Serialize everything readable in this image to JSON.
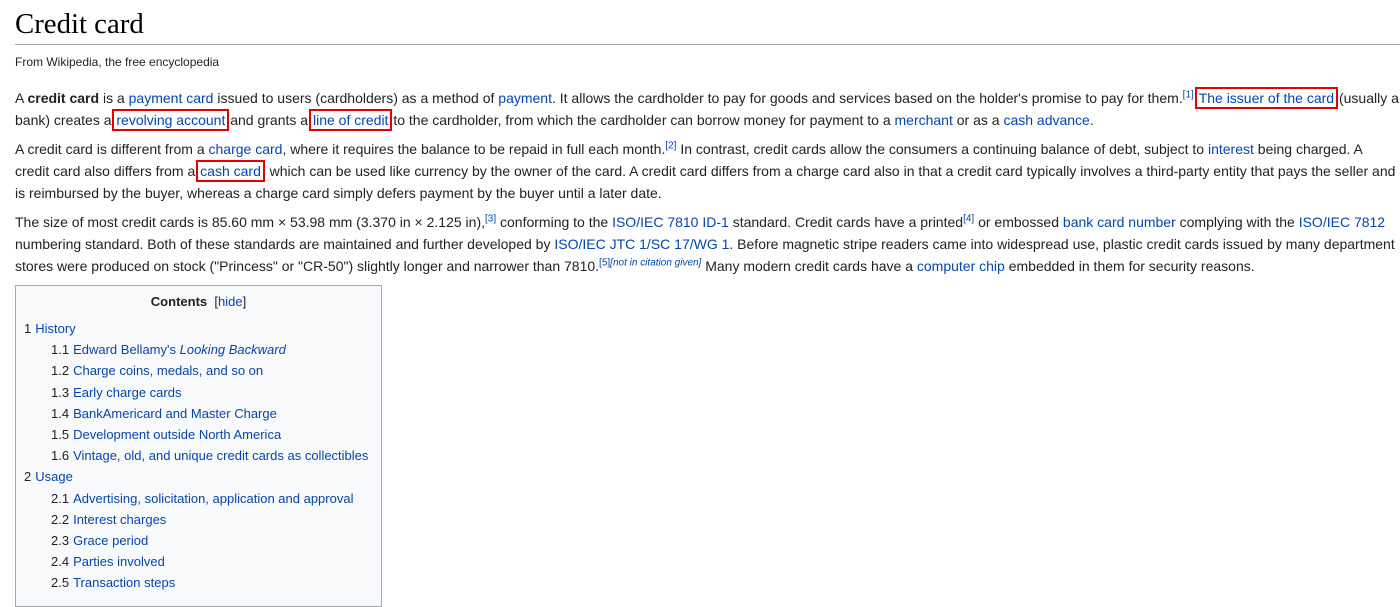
{
  "title": "Credit card",
  "subtitle": "From Wikipedia, the free encyclopedia",
  "para1": {
    "t1": "A ",
    "b1": "credit card",
    "t2": " is a ",
    "l1": "payment card",
    "t3": " issued to users (cardholders) as a method of ",
    "l2": "payment",
    "t4": ". It allows the cardholder to pay for goods and services based on the holder's promise to pay for them.",
    "s1": "[1]",
    "t5": " ",
    "h1": "The issuer of the card",
    "t6": " (usually a bank) creates a ",
    "h2": "revolving account",
    "t7": " and grants a ",
    "h3": "line of credit",
    "t8": " to the cardholder, from which the cardholder can borrow money for payment to a ",
    "l3": "merchant",
    "t9": " or as a ",
    "l4": "cash advance",
    "t10": "."
  },
  "para2": {
    "t1": "A credit card is different from a ",
    "l1": "charge card",
    "t2": ", where it requires the balance to be repaid in full each month.",
    "s1": "[2]",
    "t3": " In contrast, credit cards allow the consumers a continuing balance of debt, subject to ",
    "l2": "interest",
    "t4": " being charged. A credit card also differs from a ",
    "h1": "cash card",
    "t5": ", which can be used like currency by the owner of the card. A credit card differs from a charge card also in that a credit card typically involves a third-party entity that pays the seller and is reimbursed by the buyer, whereas a charge card simply defers payment by the buyer until a later date."
  },
  "para3": {
    "t1": "The size of most credit cards is 85.60 mm × 53.98 mm (3.370 in × 2.125 in),",
    "s1": "[3]",
    "t2": " conforming to the ",
    "l1": "ISO/IEC 7810",
    "t3": " ",
    "l2": "ID-1",
    "t4": " standard. Credit cards have a printed",
    "s2": "[4]",
    "t5": " or embossed ",
    "l3": "bank card number",
    "t6": " complying with the ",
    "l4": "ISO/IEC 7812",
    "t7": " numbering standard. Both of these standards are maintained and further developed by ",
    "l5": "ISO/IEC JTC 1/SC 17/WG 1",
    "t8": ". Before magnetic stripe readers came into widespread use, plastic credit cards issued by many department stores were produced on stock (\"Princess\" or \"CR-50\") slightly longer and narrower than 7810.",
    "s3": "[5]",
    "s4": "[not in citation given]",
    "t9": " Many modern credit cards have a ",
    "l6": "computer chip",
    "t10": " embedded in them for security reasons."
  },
  "toc": {
    "title": "Contents",
    "hide_open": "[",
    "hide": "hide",
    "hide_close": "]",
    "items": [
      {
        "num": "1",
        "label": "History"
      },
      {
        "num": "1.1",
        "label": "Edward Bellamy's ",
        "label_italic": "Looking Backward"
      },
      {
        "num": "1.2",
        "label": "Charge coins, medals, and so on"
      },
      {
        "num": "1.3",
        "label": "Early charge cards"
      },
      {
        "num": "1.4",
        "label": "BankAmericard and Master Charge"
      },
      {
        "num": "1.5",
        "label": "Development outside North America"
      },
      {
        "num": "1.6",
        "label": "Vintage, old, and unique credit cards as collectibles"
      },
      {
        "num": "2",
        "label": "Usage"
      },
      {
        "num": "2.1",
        "label": "Advertising, solicitation, application and approval"
      },
      {
        "num": "2.2",
        "label": "Interest charges"
      },
      {
        "num": "2.3",
        "label": "Grace period"
      },
      {
        "num": "2.4",
        "label": "Parties involved"
      },
      {
        "num": "2.5",
        "label": "Transaction steps"
      }
    ]
  },
  "colors": {
    "link": "#0645ad",
    "highlight_box": "#e50000",
    "text": "#222222"
  }
}
